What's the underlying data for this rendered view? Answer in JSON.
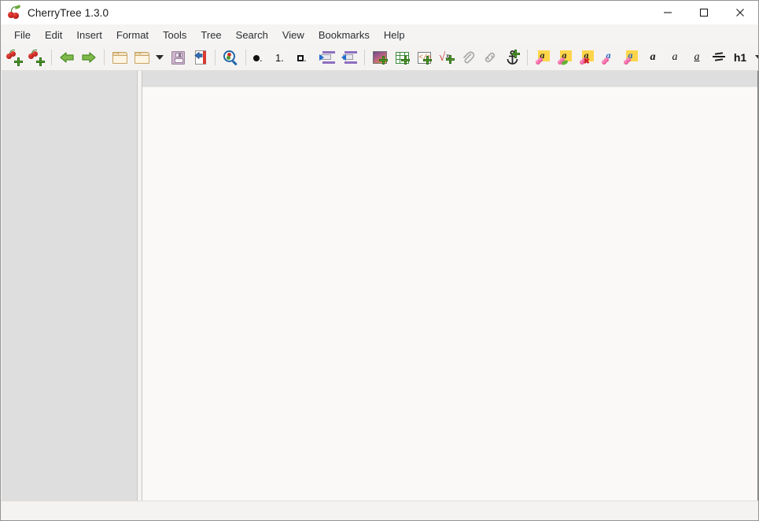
{
  "window": {
    "title": "CherryTree 1.3.0",
    "app_icon": "cherry-logo-icon",
    "controls": {
      "minimize": "minimize-icon",
      "maximize": "maximize-icon",
      "close": "close-icon"
    }
  },
  "menubar": {
    "items": [
      {
        "label": "File"
      },
      {
        "label": "Edit"
      },
      {
        "label": "Insert"
      },
      {
        "label": "Format"
      },
      {
        "label": "Tools"
      },
      {
        "label": "Tree"
      },
      {
        "label": "Search"
      },
      {
        "label": "View"
      },
      {
        "label": "Bookmarks"
      },
      {
        "label": "Help"
      }
    ]
  },
  "toolbar": {
    "groups": [
      {
        "name": "node-group",
        "buttons": [
          {
            "icon": "add-node-icon",
            "label": ""
          },
          {
            "icon": "add-subnode-icon",
            "label": ""
          }
        ]
      },
      {
        "name": "navigation-group",
        "buttons": [
          {
            "icon": "go-back-icon",
            "label": ""
          },
          {
            "icon": "go-forward-icon",
            "label": ""
          }
        ]
      },
      {
        "name": "file-group",
        "buttons": [
          {
            "icon": "open-file-icon",
            "label": ""
          },
          {
            "icon": "recent-documents-icon",
            "label": ""
          },
          {
            "icon": "recent-documents-dropdown-icon",
            "label": ""
          },
          {
            "icon": "save-icon",
            "label": ""
          },
          {
            "icon": "save-as-icon",
            "label": ""
          }
        ]
      },
      {
        "name": "search-group",
        "buttons": [
          {
            "icon": "find-in-nodes-icon",
            "label": ""
          }
        ]
      },
      {
        "name": "list-group",
        "buttons": [
          {
            "icon": "bulleted-list-icon",
            "label": ""
          },
          {
            "icon": "numbered-list-icon",
            "label": "1."
          },
          {
            "icon": "todo-list-icon",
            "label": ""
          },
          {
            "icon": "increase-indent-icon",
            "label": ""
          },
          {
            "icon": "decrease-indent-icon",
            "label": ""
          }
        ]
      },
      {
        "name": "insert-group",
        "buttons": [
          {
            "icon": "insert-image-icon",
            "label": ""
          },
          {
            "icon": "insert-table-icon",
            "label": ""
          },
          {
            "icon": "insert-codebox-icon",
            "label": ""
          },
          {
            "icon": "insert-formula-icon",
            "label": ""
          },
          {
            "icon": "attach-file-icon",
            "label": ""
          },
          {
            "icon": "insert-link-icon",
            "label": ""
          },
          {
            "icon": "insert-anchor-icon",
            "label": ""
          }
        ]
      },
      {
        "name": "format-group",
        "buttons": [
          {
            "icon": "text-background-color-icon",
            "label": "a"
          },
          {
            "icon": "apply-last-background-icon",
            "label": "a"
          },
          {
            "icon": "remove-formatting-icon",
            "label": "a"
          },
          {
            "icon": "text-foreground-color-icon",
            "label": "a"
          },
          {
            "icon": "apply-last-foreground-icon",
            "label": "a"
          },
          {
            "icon": "bold-icon",
            "label": "a"
          },
          {
            "icon": "italic-icon",
            "label": "a"
          },
          {
            "icon": "underline-icon",
            "label": "a"
          },
          {
            "icon": "strikethrough-icon",
            "label": ""
          },
          {
            "icon": "heading-h1-icon",
            "label": "h1"
          },
          {
            "icon": "toolbar-overflow-chevron-icon",
            "label": ""
          }
        ]
      }
    ]
  },
  "tree": {
    "nodes": [],
    "empty": true
  },
  "editor": {
    "header_text": "",
    "content": "",
    "placeholder": ""
  },
  "statusbar": {
    "text": ""
  },
  "colors": {
    "titlebar_bg": "#ffffff",
    "menubar_bg": "#f5f4f3",
    "toolbar_bg": "#f4f3f2",
    "tree_bg": "#dedede",
    "editor_bg": "#faf9f7",
    "statusbar_bg": "#f4f3f2",
    "window_border": "#949494",
    "text": "#2d2f33"
  }
}
